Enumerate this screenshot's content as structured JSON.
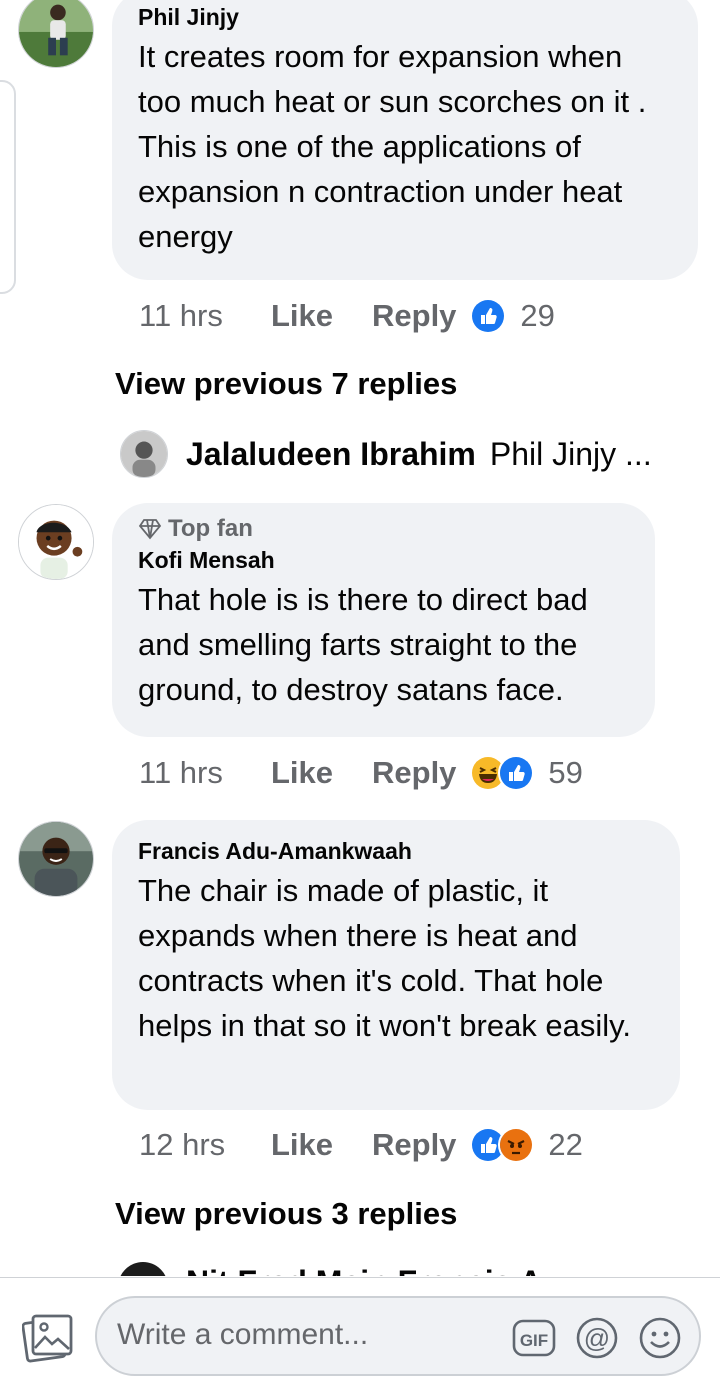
{
  "comments": [
    {
      "author": "Phil Jinjy",
      "text": "It creates room for expansion when too much heat or sun scorches on it . This is one of the applications of expansion n contraction under heat energy",
      "time": "11 hrs",
      "like_label": "Like",
      "reply_label": "Reply",
      "reactions": [
        "like"
      ],
      "reaction_count": "29"
    },
    {
      "badge": "Top fan",
      "author": "Kofi Mensah",
      "text": "That hole is is there to direct bad and smelling farts straight to the ground, to destroy satans face.",
      "time": "11 hrs",
      "like_label": "Like",
      "reply_label": "Reply",
      "reactions": [
        "haha",
        "like"
      ],
      "reaction_count": "59"
    },
    {
      "author": "Francis Adu-Amankwaah",
      "text": "The chair is made of plastic, it expands when there is heat and contracts when it's cold. That hole helps in that so it won't break easily.",
      "time": "12 hrs",
      "like_label": "Like",
      "reply_label": "Reply",
      "reactions": [
        "like",
        "angry"
      ],
      "reaction_count": "22"
    }
  ],
  "view_previous_1": "View previous 7 replies",
  "reply_preview": {
    "author": "Jalaludeen Ibrahim",
    "text": "Phil Jinjy ..."
  },
  "view_previous_2": "View previous 3 replies",
  "cut_row_text": "Nit          Fred Mein   Francis A",
  "composer": {
    "placeholder": "Write a comment...",
    "icons": [
      "photo-icon",
      "gif-icon",
      "mention-icon",
      "emoji-icon"
    ]
  },
  "colors": {
    "bubble": "#f0f2f5",
    "meta": "#65676b",
    "like_blue": "#1877f2",
    "haha_yellow": "#f7b928",
    "angry_orange": "#e9710f"
  }
}
